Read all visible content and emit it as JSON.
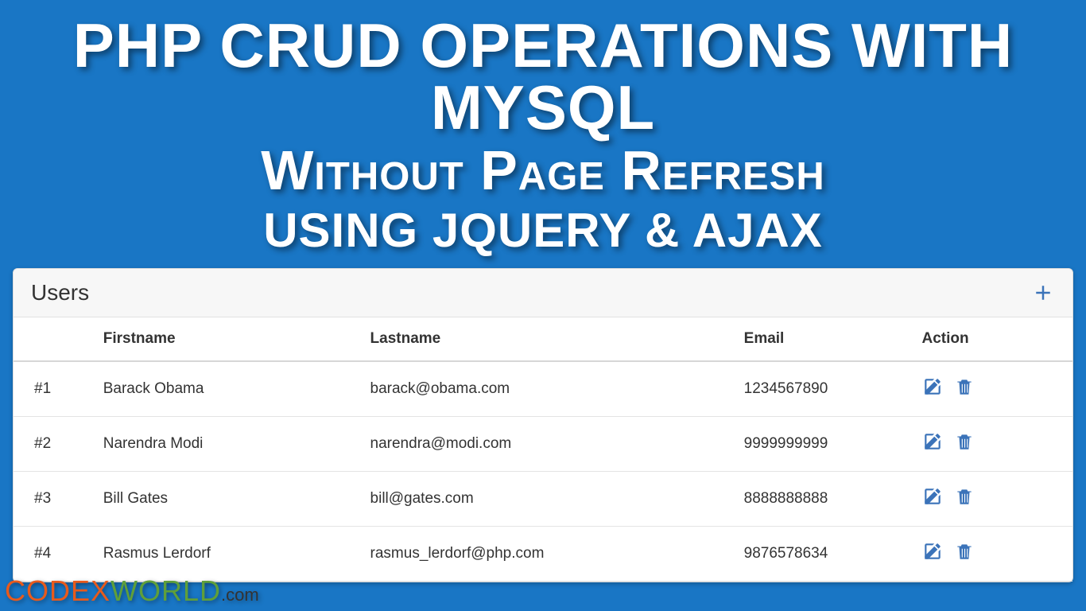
{
  "hero": {
    "line1": "PHP CRUD OPERATIONS WITH MYSQL",
    "line2": "Without Page Refresh",
    "line3": "using jQuery & Ajax"
  },
  "panel": {
    "title": "Users"
  },
  "table": {
    "headers": {
      "idx": "",
      "first": "Firstname",
      "last": "Lastname",
      "email": "Email",
      "action": "Action"
    },
    "rows": [
      {
        "idx": "#1",
        "first": "Barack Obama",
        "last": "barack@obama.com",
        "email": "1234567890"
      },
      {
        "idx": "#2",
        "first": "Narendra Modi",
        "last": "narendra@modi.com",
        "email": "9999999999"
      },
      {
        "idx": "#3",
        "first": "Bill Gates",
        "last": "bill@gates.com",
        "email": "8888888888"
      },
      {
        "idx": "#4",
        "first": "Rasmus Lerdorf",
        "last": "rasmus_lerdorf@php.com",
        "email": "9876578634"
      }
    ]
  },
  "brand": {
    "part1": "CODEX",
    "part2": "WORLD",
    "part3": ".com"
  }
}
